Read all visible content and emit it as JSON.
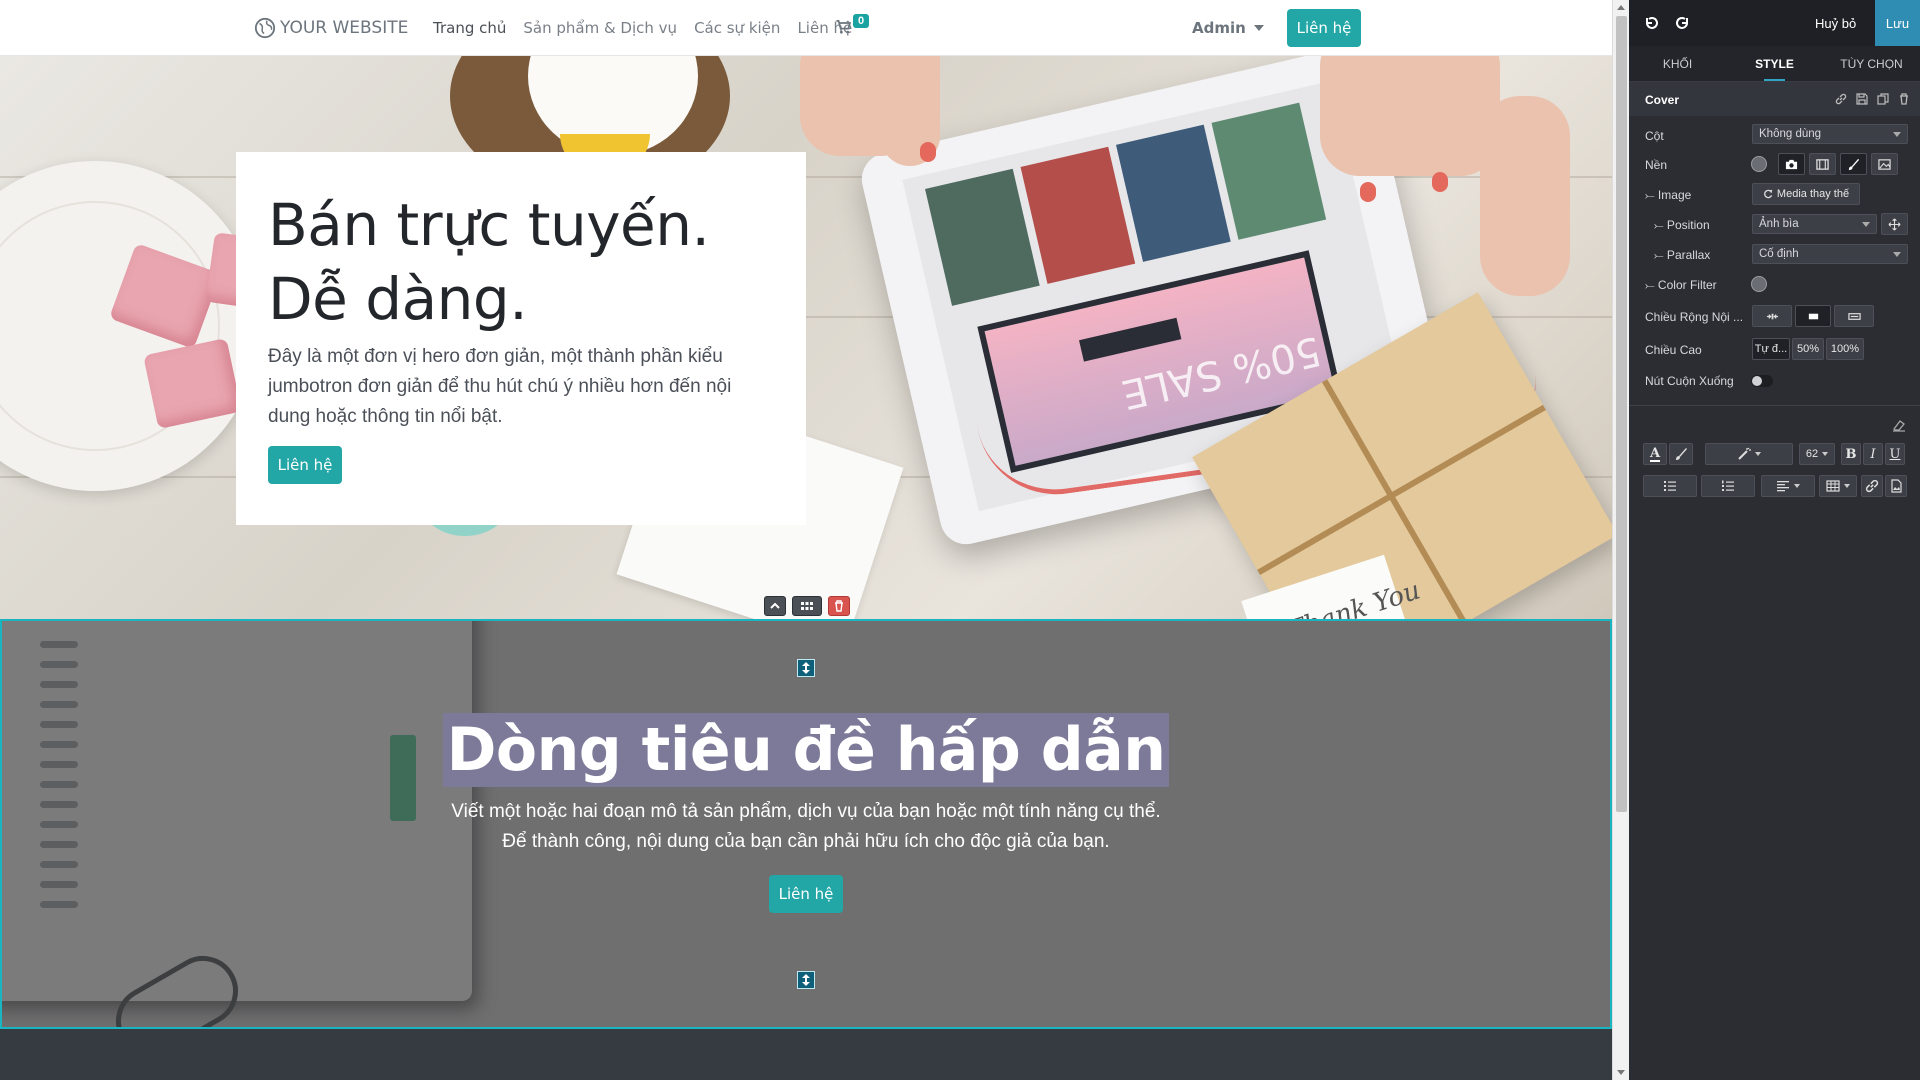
{
  "header": {
    "brand": "YOUR WEBSITE",
    "nav": [
      "Trang chủ",
      "Sản phẩm & Dịch vụ",
      "Các sự kiện",
      "Liên hệ"
    ],
    "cart_count": "0",
    "user": "Admin",
    "cta": "Liên hệ"
  },
  "hero": {
    "title": "Bán trực tuyến. Dễ dàng.",
    "text": "Đây là một đơn vị hero đơn giản, một thành phần kiểu jumbotron đơn giản để thu hút chú ý nhiều hơn đến nội dung hoặc thông tin nổi bật.",
    "button": "Liên hệ"
  },
  "hero_image": {
    "sale_text": "50% SALE",
    "tag_text": "Thank You"
  },
  "banner": {
    "title": "Dòng tiêu đề hấp dẫn",
    "text_line1": "Viết một hoặc hai đoạn mô tả sản phẩm, dịch vụ của bạn hoặc một tính năng cụ thể.",
    "text_line2": "Để thành công, nội dung của bạn cần phải hữu ích cho độc giả của bạn.",
    "button": "Liên hệ"
  },
  "editor": {
    "discard": "Huỷ bỏ",
    "save": "Lưu",
    "tabs": [
      "KHỐI",
      "STYLE",
      "TÙY CHỌN"
    ],
    "active_tab": "STYLE",
    "section_title": "Cover",
    "rows": {
      "columns_label": "Cột",
      "columns_value": "Không dùng",
      "background_label": "Nền",
      "image_label": "⤚ Image",
      "image_button": "Media thay thế",
      "position_label": "⤚ Position",
      "position_value": "Ảnh bìa",
      "parallax_label": "⤚ Parallax",
      "parallax_value": "Cố định",
      "color_filter_label": "⤚ Color Filter",
      "content_width_label": "Chiều Rộng Nội ...",
      "height_label": "Chiều Cao",
      "height_options": [
        "Tự đ...",
        "50%",
        "100%"
      ],
      "scroll_button_label": "Nút Cuộn Xuống"
    },
    "font_size": "62",
    "format_buttons": [
      "B",
      "I",
      "U"
    ]
  },
  "colors": {
    "accent": "#22a6a6",
    "editor_bg": "#2b2d33",
    "save_bg": "#2f8db3",
    "selection": "#19b5c1"
  }
}
